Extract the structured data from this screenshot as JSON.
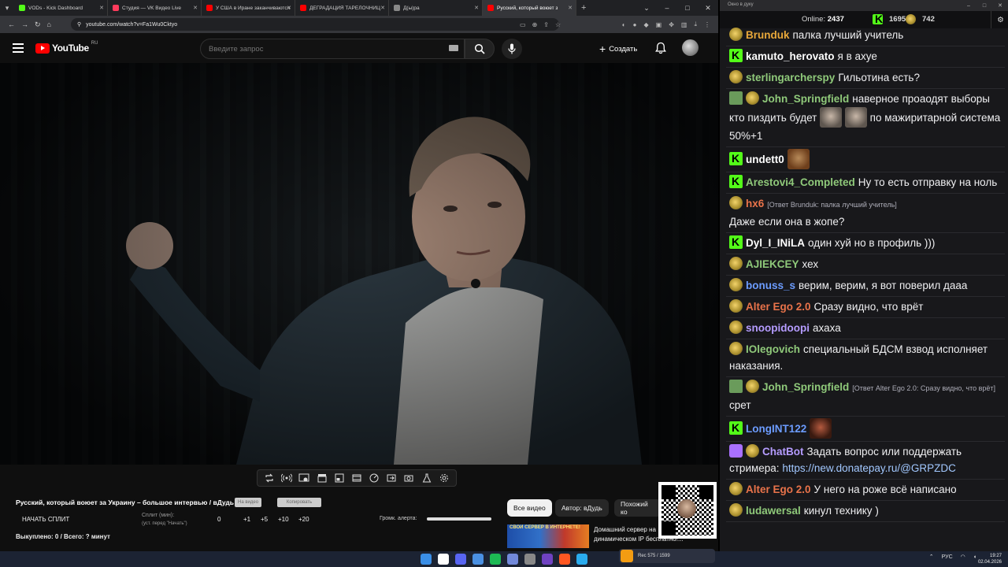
{
  "browser": {
    "tabs": [
      {
        "label": "VODs - Kick Dashboard",
        "color": "#53fc18",
        "active": false
      },
      {
        "label": "Студия — VK Видео Live",
        "color": "#ff3b5c",
        "active": false
      },
      {
        "label": "У США в Иране заканчиваются",
        "color": "#ff0000",
        "active": false
      },
      {
        "label": "ДЕГРАДАЦИЯ ТАРЕЛОЧНИЦ",
        "color": "#ff0000",
        "active": false
      },
      {
        "label": "Д(ы)ра",
        "color": "#888888",
        "active": false
      },
      {
        "label": "Русский, который воюет з",
        "color": "#ff0000",
        "active": true
      }
    ],
    "url": "youtube.com/watch?v=Fa1Wu0Cktyo"
  },
  "youtube": {
    "logo_text": "YouTube",
    "logo_region": "RU",
    "search_placeholder": "Введите запрос",
    "create_label": "Создать"
  },
  "player_tools": [
    "repeat-icon",
    "broadcast-icon",
    "screen-record-icon",
    "clapper-icon",
    "pip-icon",
    "frames-icon",
    "speed-icon",
    "export-icon",
    "camera-icon",
    "flask-icon",
    "settings-icon"
  ],
  "below_video": {
    "title": "Русский, который воюет за Украину – большое интервью / вДудь",
    "btn_on_video": "На видео",
    "btn_copy": "Копировать",
    "start_split": "НАЧАТЬ СПЛИТ",
    "split_min_label": "Сплит (мин):",
    "split_min_hint": "(уст. перед \"Начать\")",
    "split_values": [
      "0",
      "+1",
      "+5",
      "+10",
      "+20"
    ],
    "bought": "Выкуплено: 0 / Всего: ? минут",
    "alert_volume_label": "Громк. алерта:",
    "alert_volume": 1.0,
    "chips": [
      {
        "label": "Все видео",
        "selected": true
      },
      {
        "label": "Автор: вДудь",
        "selected": false
      },
      {
        "label": "Похожий ко",
        "selected": false
      }
    ],
    "rec_banner": "СВОЙ СЕРВЕР В ИНТЕРНЕТЕ!",
    "rec_title_1": "Домашний сервер на",
    "rec_title_2": "динамическом IP бесплатно!..."
  },
  "chat": {
    "window_title": "Окно в дуку",
    "online_label": "Online:",
    "online": "2437",
    "kick_count": "1695",
    "pepe_count": "742",
    "messages": [
      {
        "badges": [
          "pepe"
        ],
        "user": "Brunduk",
        "color": "#e9a83a",
        "text": "палка лучший учитель"
      },
      {
        "badges": [
          "kick"
        ],
        "user": "kamuto_herovato",
        "color": "#ffffff",
        "text": "я в ахуе"
      },
      {
        "badges": [
          "pepe"
        ],
        "user": "sterlingarcherspy",
        "color": "#8fc97a",
        "text": "Гильотина есть?"
      },
      {
        "badges": [
          "check",
          "pepe"
        ],
        "user": "John_Springfield",
        "color": "#8fc97a",
        "text": "наверное проаодят выборы кто пиздить будет",
        "emotes": [
          "e1",
          "e1"
        ],
        "text2": "по мажиритарной система 50%+1"
      },
      {
        "badges": [
          "kick"
        ],
        "user": "undett0",
        "color": "#ffffff",
        "text": "",
        "emotes": [
          "e2"
        ]
      },
      {
        "badges": [
          "kick"
        ],
        "user": "Arestovi4_Completed",
        "color": "#8fc97a",
        "text": "Ну то есть отправку на ноль"
      },
      {
        "badges": [
          "pepe"
        ],
        "user": "hx6",
        "color": "#e9734a",
        "reply": "[Ответ Brunduk: палка лучший учитель]",
        "text": "Даже если она в жопе?"
      },
      {
        "badges": [
          "kick"
        ],
        "user": "Dyl_I_INiLA",
        "color": "#ffffff",
        "text": "один хуй но в профиль )))"
      },
      {
        "badges": [
          "pepe"
        ],
        "user": "AJIEKCEY",
        "color": "#8fc97a",
        "text": "хех"
      },
      {
        "badges": [
          "pepe"
        ],
        "user": "bonuss_s",
        "color": "#6c9cff",
        "text": "верим, верим, я вот поверил дааа"
      },
      {
        "badges": [
          "pepe"
        ],
        "user": "Alter Ego 2.0",
        "color": "#e9734a",
        "text": "Сразу видно, что врёт"
      },
      {
        "badges": [
          "pepe"
        ],
        "user": "snoopidoopi",
        "color": "#b59cff",
        "text": "ахаха"
      },
      {
        "badges": [
          "pepe"
        ],
        "user": "IOlegovich",
        "color": "#8fc97a",
        "text": "специальный БДСМ взвод исполняет наказания."
      },
      {
        "badges": [
          "check",
          "pepe"
        ],
        "user": "John_Springfield",
        "color": "#8fc97a",
        "reply": "[Ответ Alter Ego 2.0: Сразу видно, что врёт]",
        "text": "срет"
      },
      {
        "badges": [
          "kick"
        ],
        "user": "LongINT122",
        "color": "#6c9cff",
        "text": "",
        "emotes": [
          "e3"
        ]
      },
      {
        "badges": [
          "robot",
          "pepe"
        ],
        "user": "ChatBot",
        "color": "#b59cff",
        "text": "Задать вопрос или поддержать стримера:",
        "link": "https://new.donatepay.ru/@GRPZDC"
      },
      {
        "badges": [
          "pepe"
        ],
        "user": "Alter Ego 2.0",
        "color": "#e9734a",
        "text": "У него на роже всё написано"
      },
      {
        "badges": [
          "pepe"
        ],
        "user": "ludawersal",
        "color": "#8fc97a",
        "text": "кинул технику )"
      }
    ]
  },
  "taskbar": {
    "media_text": "Rec 575 / 1599",
    "lang": "РУС",
    "time": "19:27",
    "date": "02.04.2026",
    "app_colors": [
      "#3a8ee6",
      "#ffffff",
      "#5865f2",
      "#4a90e2",
      "#1db954",
      "#7289da",
      "#888888",
      "#6f42c1",
      "#ff5722",
      "#2aabee"
    ]
  }
}
